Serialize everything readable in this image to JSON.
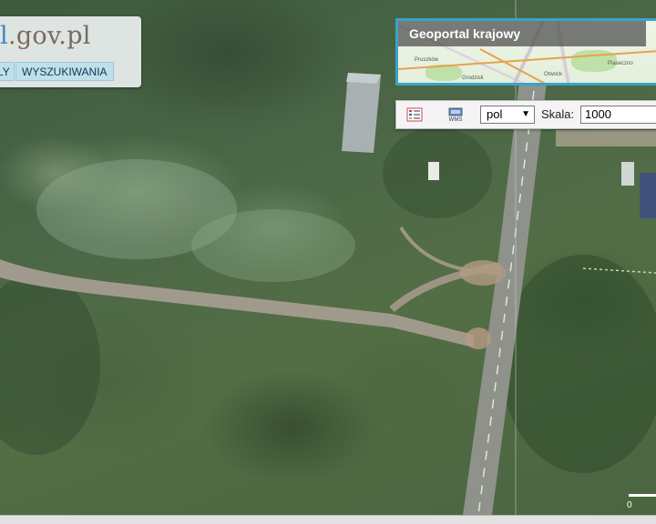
{
  "logo": {
    "text_accent": "l",
    "text_rest": ".gov.pl"
  },
  "nav": {
    "mapy_label": "LY",
    "search_label": "WYSZUKIWANIA"
  },
  "preview": {
    "title": "Geoportal krajowy",
    "towns": [
      "Pruszków",
      "Otwock",
      "Grodzisk",
      "Piaseczno"
    ]
  },
  "toolbar": {
    "legend_icon": "legend-icon",
    "wms_icon": "wms-icon",
    "lang_value": "pol",
    "scale_label": "Skala:",
    "scale_value": "1000"
  },
  "map": {
    "scale_zero": "0"
  },
  "colors": {
    "accent": "#3aa3c9",
    "nav_button": "#bfe0ea",
    "logo_accent": "#3f86c4"
  }
}
